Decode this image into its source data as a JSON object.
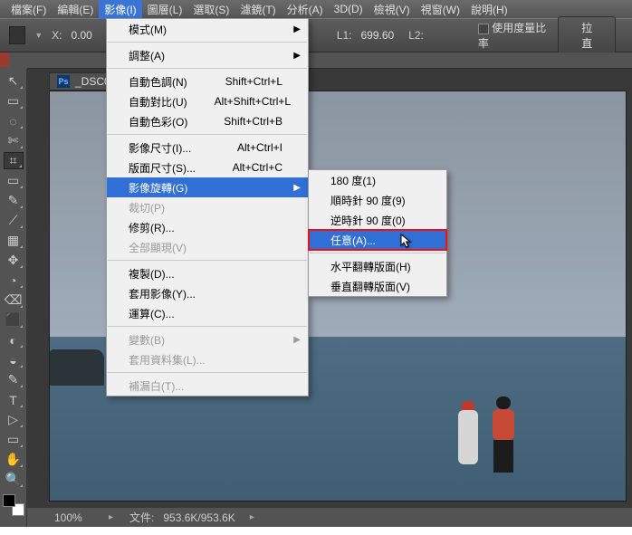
{
  "menubar": {
    "items": [
      {
        "label": "檔案(F)"
      },
      {
        "label": "編輯(E)"
      },
      {
        "label": "影像(I)"
      },
      {
        "label": "圖層(L)"
      },
      {
        "label": "選取(S)"
      },
      {
        "label": "濾鏡(T)"
      },
      {
        "label": "分析(A)"
      },
      {
        "label": "3D(D)"
      },
      {
        "label": "檢視(V)"
      },
      {
        "label": "視窗(W)"
      },
      {
        "label": "說明(H)"
      }
    ],
    "active_index": 2
  },
  "optbar": {
    "x_label": "X:",
    "x_value": "0.00",
    "l1_label": "L1:",
    "l1_value": "699.60",
    "l2_label": "L2:",
    "use_scale": "使用度量比率",
    "btn": "拉直"
  },
  "tab": {
    "prefix": "_DSC0"
  },
  "image_menu": [
    {
      "label": "模式(M)",
      "arrow": true
    },
    {
      "sep": true
    },
    {
      "label": "調整(A)",
      "arrow": true
    },
    {
      "sep": true
    },
    {
      "label": "自動色調(N)",
      "shortcut": "Shift+Ctrl+L"
    },
    {
      "label": "自動對比(U)",
      "shortcut": "Alt+Shift+Ctrl+L"
    },
    {
      "label": "自動色彩(O)",
      "shortcut": "Shift+Ctrl+B"
    },
    {
      "sep": true
    },
    {
      "label": "影像尺寸(I)...",
      "shortcut": "Alt+Ctrl+I"
    },
    {
      "label": "版面尺寸(S)...",
      "shortcut": "Alt+Ctrl+C"
    },
    {
      "label": "影像旋轉(G)",
      "arrow": true,
      "highlight": true
    },
    {
      "label": "裁切(P)",
      "disabled": true
    },
    {
      "label": "修剪(R)..."
    },
    {
      "label": "全部顯現(V)",
      "disabled": true
    },
    {
      "sep": true
    },
    {
      "label": "複製(D)..."
    },
    {
      "label": "套用影像(Y)..."
    },
    {
      "label": "運算(C)..."
    },
    {
      "sep": true
    },
    {
      "label": "變數(B)",
      "arrow": true,
      "disabled": true
    },
    {
      "label": "套用資料集(L)...",
      "disabled": true
    },
    {
      "sep": true
    },
    {
      "label": "補漏白(T)...",
      "disabled": true
    }
  ],
  "rotate_menu": [
    {
      "label": "180 度(1)"
    },
    {
      "label": "順時針 90 度(9)"
    },
    {
      "label": "逆時針 90 度(0)"
    },
    {
      "label": "任意(A)...",
      "highlight": true
    },
    {
      "sep": true
    },
    {
      "label": "水平翻轉版面(H)"
    },
    {
      "label": "垂直翻轉版面(V)"
    }
  ],
  "status": {
    "zoom": "100%",
    "doc_label": "文件:",
    "doc": "953.6K/953.6K"
  },
  "tools": [
    "↖",
    "▭",
    "◌",
    "✄",
    "⌗",
    "▭",
    "✎",
    "⟋",
    "▦",
    "✥",
    "◔",
    "⌫",
    "⬛",
    "◐",
    "◒",
    "✎",
    "T",
    "▷",
    "▭",
    "✋",
    "🔍"
  ]
}
